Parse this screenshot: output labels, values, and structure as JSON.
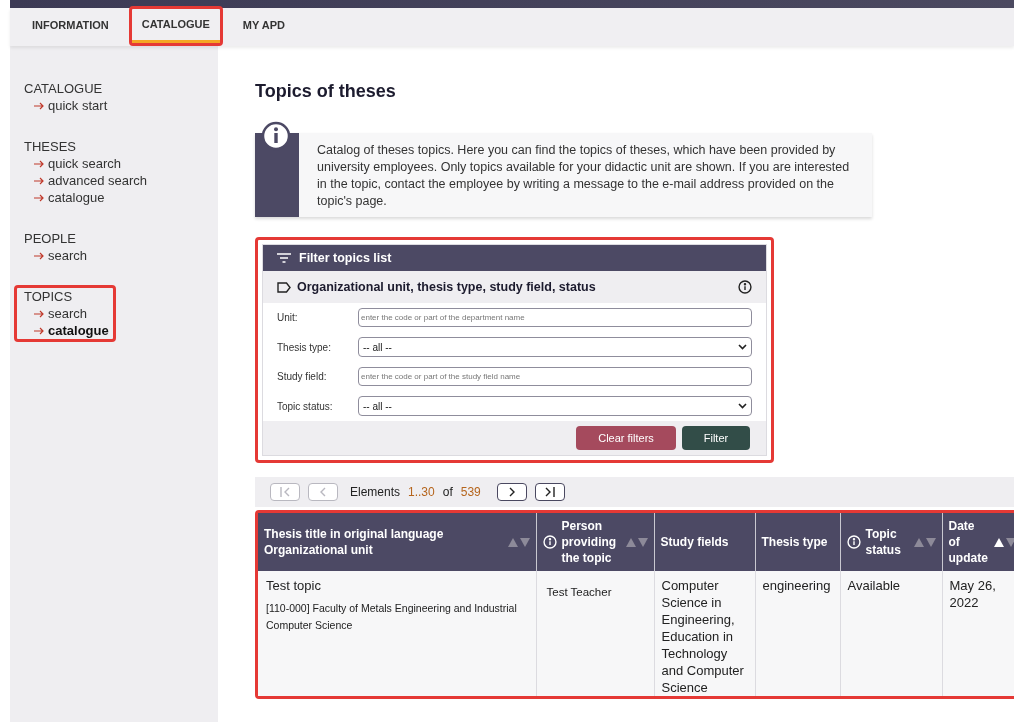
{
  "tabs": [
    {
      "label": "INFORMATION",
      "selected": false,
      "highlighted": false
    },
    {
      "label": "CATALOGUE",
      "selected": true,
      "highlighted": true
    },
    {
      "label": "MY APD",
      "selected": false,
      "highlighted": false
    }
  ],
  "sidebar": {
    "sections": [
      {
        "title": "CATALOGUE",
        "highlighted": false,
        "items": [
          {
            "label": "quick start",
            "selected": false
          }
        ]
      },
      {
        "title": "THESES",
        "highlighted": false,
        "items": [
          {
            "label": "quick search",
            "selected": false
          },
          {
            "label": "advanced search",
            "selected": false
          },
          {
            "label": "catalogue",
            "selected": false
          }
        ]
      },
      {
        "title": "PEOPLE",
        "highlighted": false,
        "items": [
          {
            "label": "search",
            "selected": false
          }
        ]
      },
      {
        "title": "TOPICS",
        "highlighted": true,
        "items": [
          {
            "label": "search",
            "selected": false
          },
          {
            "label": "catalogue",
            "selected": true
          }
        ]
      }
    ]
  },
  "page_title": "Topics of theses",
  "info_note": "Catalog of theses topics. Here you can find the topics of theses, which have been provided by university employees. Only topics available for your didactic unit are shown. If you are interested in the topic, contact the employee by writing a message to the e-mail address provided on the topic's page.",
  "filter": {
    "title": "Filter topics list",
    "highlighted": true,
    "section_title": "Organizational unit, thesis type, study field, status",
    "fields": [
      {
        "kind": "text",
        "label": "Unit:",
        "placeholder": "enter the code or part of the department name"
      },
      {
        "kind": "select",
        "label": "Thesis type:",
        "value": "-- all --"
      },
      {
        "kind": "text",
        "label": "Study field:",
        "placeholder": "enter the code or part of the study field name"
      },
      {
        "kind": "select",
        "label": "Topic status:",
        "value": "-- all --"
      }
    ],
    "buttons": [
      {
        "kind": "secondary",
        "label": "Clear filters"
      },
      {
        "kind": "primary",
        "label": "Filter"
      }
    ]
  },
  "pagination": {
    "first_disabled": true,
    "prev_disabled": true,
    "next_disabled": false,
    "last_disabled": false,
    "label": "Elements",
    "range": "1..30",
    "of": "of",
    "total": "539"
  },
  "table": {
    "highlighted": true,
    "columns": [
      {
        "lines": [
          "Thesis title in original language",
          "Organizational unit"
        ],
        "info": false,
        "sortable": true,
        "sorted_ascending": false
      },
      {
        "lines": [
          "Person providing the topic"
        ],
        "info": true,
        "sortable": true,
        "sorted_ascending": false
      },
      {
        "lines": [
          "Study fields"
        ],
        "info": false,
        "sortable": false
      },
      {
        "lines": [
          "Thesis type"
        ],
        "info": false,
        "sortable": false
      },
      {
        "lines": [
          "Topic status"
        ],
        "info": true,
        "sortable": true,
        "sorted_ascending": false
      },
      {
        "lines": [
          "Date of update"
        ],
        "info": false,
        "sortable": true,
        "sorted_ascending": true
      }
    ],
    "rows": [
      {
        "title": "Test topic",
        "unit": "[110-000] Faculty of Metals Engineering and Industrial Computer Science",
        "person": "Test Teacher",
        "study_fields": "Computer Science in Engineering, Education in Technology and Computer Science",
        "type": "engineering",
        "status": "Available",
        "date": "May 26, 2022"
      }
    ]
  }
}
